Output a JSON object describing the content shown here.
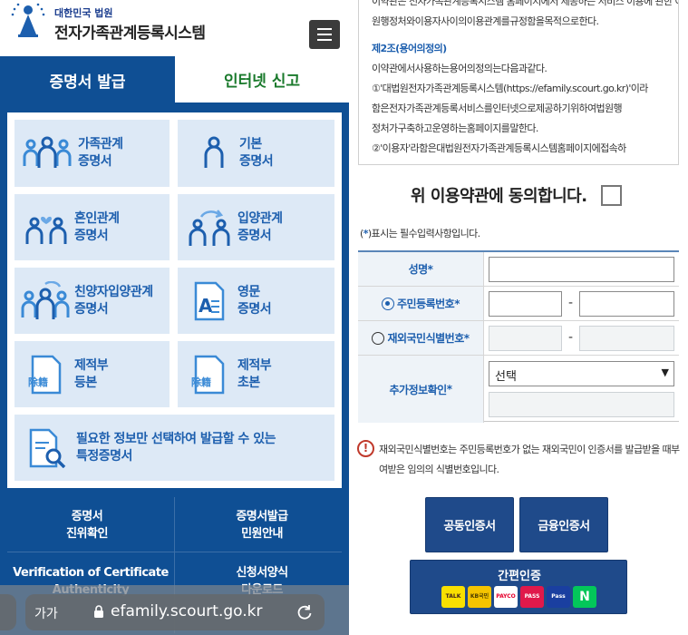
{
  "header": {
    "org_small": "대한민국 법원",
    "site_title": "전자가족관계등록시스템"
  },
  "tabs": [
    {
      "label": "증명서 발급",
      "active": true
    },
    {
      "label": "인터넷 신고",
      "active": false
    }
  ],
  "cards": [
    {
      "label": "가족관계\n증명서",
      "icon": "family-icon"
    },
    {
      "label": "기본\n증명서",
      "icon": "person-icon"
    },
    {
      "label": "혼인관계\n증명서",
      "icon": "marriage-icon"
    },
    {
      "label": "입양관계\n증명서",
      "icon": "adoption-icon"
    },
    {
      "label": "친양자입양관계\n증명서",
      "icon": "adoption-family-icon"
    },
    {
      "label": "영문\n증명서",
      "icon": "english-document-icon"
    },
    {
      "label": "제적부\n등본",
      "icon": "register-document-icon"
    },
    {
      "label": "제적부\n초본",
      "icon": "register-document-icon"
    },
    {
      "label": "필요한 정보만 선택하여 발급할 수 있는\n특정증명서",
      "icon": "search-document-icon"
    }
  ],
  "register_badge": "除籍",
  "doc_badge": "A",
  "links": [
    {
      "label": "증명서\n진위확인"
    },
    {
      "label": "증명서발급\n민원안내"
    },
    {
      "label": "Verification of Certificate\nAuthenticity"
    },
    {
      "label": "신청서양식\n다운로드"
    }
  ],
  "browser": {
    "text_size": "가가",
    "url": "efamily.scourt.go.kr"
  },
  "terms": {
    "lines_top": [
      "이약관은 전자가족관계등록시스템 홈페이지에서 제공하는 서비스 이용에 관한 이용조건과 절",
      "원행정처와이용자사이의이용관계를규정함을목적으로한다."
    ],
    "article2_title": "제2조(용어의정의)",
    "article2_lines": [
      "이약관에서사용하는용어의정의는다음과같다.",
      "①'대법원전자가족관계등록시스템(https://efamily.scourt.go.kr)'이라",
      "함은전자가족관계등록서비스를인터넷으로제공하기위하여법원행",
      "정처가구축하고운영하는홈페이지를말한다.",
      "②'이용자'라함은대법원전자가족관계등록시스템홈페이지에접속하"
    ]
  },
  "agree_label": "위 이용약관에 동의합니다.",
  "required_note": {
    "prefix": "(",
    "star": "*",
    "suffix": ")표시는 필수입력사항입니다."
  },
  "form": {
    "name_label": "성명",
    "rrn_label": "주민등록번호",
    "foreign_label": "재외국민식별번호",
    "extra_label": "추가정보확인",
    "star": "*",
    "dash": "-",
    "select_value": "선택",
    "rrn_selected": true
  },
  "warning": "재외국민식별번호는 주민등록번호가 없는 재외국민이 인증서를 발급받을 때부여받은 임의의 식별번호입니다.",
  "buttons": {
    "joint_cert": "공동인증서",
    "financial_cert": "금융인증서",
    "simple_auth": "간편인증"
  },
  "simple_icons": [
    {
      "name": "kakao",
      "text": "TALK",
      "bg": "#f9e000",
      "fg": "#3b1e1e"
    },
    {
      "name": "kb",
      "text": "KB국민",
      "bg": "#f5c400",
      "fg": "#4a3b00"
    },
    {
      "name": "payco",
      "text": "PAYCO",
      "bg": "#ffffff",
      "fg": "#e6002d"
    },
    {
      "name": "pass",
      "text": "PASS",
      "bg": "#e0194b",
      "fg": "#ffffff"
    },
    {
      "name": "samsung-pass",
      "text": "Pass",
      "bg": "#1a3fa0",
      "fg": "#ffffff"
    },
    {
      "name": "naver",
      "text": "N",
      "bg": "#03c75a",
      "fg": "#ffffff"
    }
  ],
  "colors": {
    "primary_blue": "#0f4f94",
    "accent_green": "#1a7a2c",
    "card_bg": "#dde9f6",
    "button_navy": "#1f4a8a"
  }
}
